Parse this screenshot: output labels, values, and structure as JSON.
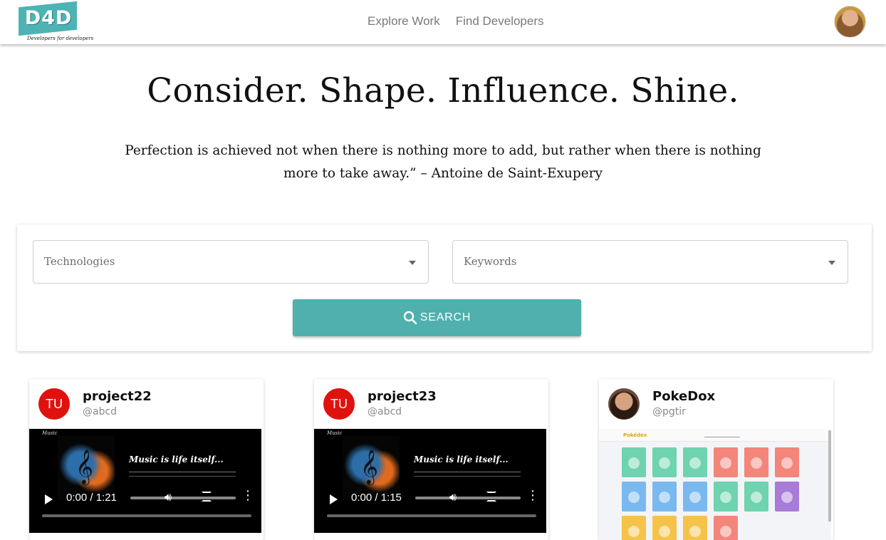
{
  "header": {
    "logo_text": "D4D",
    "logo_tagline": "Developers for developers",
    "nav": [
      "Explore Work",
      "Find Developers"
    ]
  },
  "hero": {
    "title": "Consider. Shape. Influence. Shine.",
    "quote": "Perfection is achieved not when there is nothing more to add, but rather when there is nothing more to take away.” – Antoine de Saint-Exupery"
  },
  "search": {
    "technologies_placeholder": "Technologies",
    "keywords_placeholder": "Keywords",
    "button_label": "SEARCH"
  },
  "colors": {
    "accent": "#4fb0ae",
    "avatar_red": "#e0120f"
  },
  "projects": [
    {
      "name": "project22",
      "handle": "@abcd",
      "avatar_initials": "TU",
      "media": {
        "label": "Music",
        "title": "Music is life itself...",
        "time": "0:00 / 1:21"
      }
    },
    {
      "name": "project23",
      "handle": "@abcd",
      "avatar_initials": "TU",
      "media": {
        "label": "Music",
        "title": "Music is life itself...",
        "time": "0:00 / 1:15"
      }
    },
    {
      "name": "PokeDox",
      "handle": "@pgtir",
      "preview_logo": "Pokédex"
    }
  ]
}
